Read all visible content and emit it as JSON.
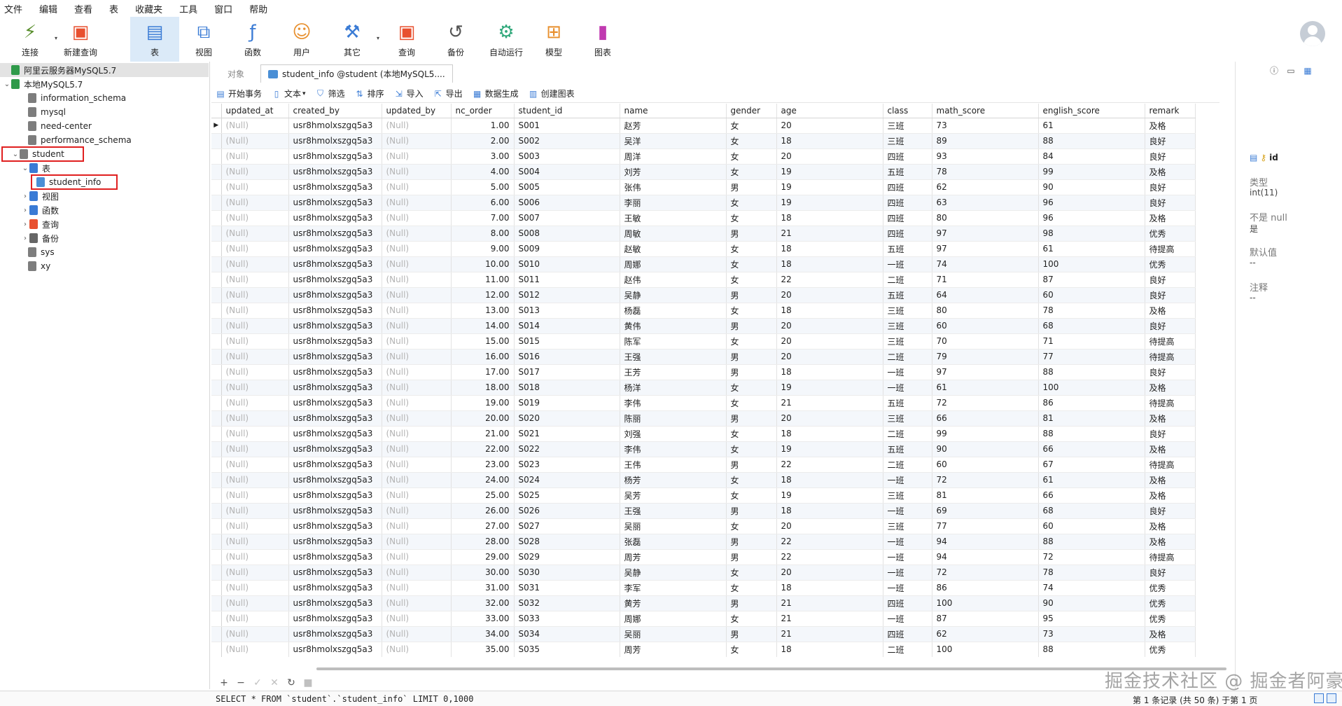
{
  "menu": [
    "文件",
    "编辑",
    "查看",
    "表",
    "收藏夹",
    "工具",
    "窗口",
    "帮助"
  ],
  "toolbar": [
    {
      "label": "连接",
      "icon": "connection-icon",
      "dropdown": true,
      "active": false,
      "color": "#5a8f2e"
    },
    {
      "label": "新建查询",
      "icon": "new-query-icon",
      "dropdown": false,
      "active": false,
      "color": "#e8502f"
    },
    {
      "label": "表",
      "icon": "table-icon",
      "dropdown": false,
      "active": true,
      "color": "#3a7bd5"
    },
    {
      "label": "视图",
      "icon": "view-icon",
      "dropdown": false,
      "active": false,
      "color": "#3a7bd5"
    },
    {
      "label": "函数",
      "icon": "function-icon",
      "dropdown": false,
      "active": false,
      "color": "#3a7bd5"
    },
    {
      "label": "用户",
      "icon": "user-icon",
      "dropdown": false,
      "active": false,
      "color": "#e8902f"
    },
    {
      "label": "其它",
      "icon": "other-tools-icon",
      "dropdown": true,
      "active": false,
      "color": "#3a7bd5"
    },
    {
      "label": "查询",
      "icon": "query-icon",
      "dropdown": false,
      "active": false,
      "color": "#e8502f"
    },
    {
      "label": "备份",
      "icon": "backup-icon",
      "dropdown": false,
      "active": false,
      "color": "#555555"
    },
    {
      "label": "自动运行",
      "icon": "auto-run-icon",
      "dropdown": false,
      "active": false,
      "color": "#2fa87a"
    },
    {
      "label": "模型",
      "icon": "model-icon",
      "dropdown": false,
      "active": false,
      "color": "#e8902f"
    },
    {
      "label": "图表",
      "icon": "chart-icon",
      "dropdown": false,
      "active": false,
      "color": "#c03ab0"
    }
  ],
  "sidebar": {
    "items": [
      {
        "label": "阿里云服务器MySQL5.7",
        "icon": "server-icon",
        "level": 0,
        "arrow": "",
        "selected": true
      },
      {
        "label": "本地MySQL5.7",
        "icon": "server-icon",
        "level": 0,
        "arrow": "⌄",
        "selected": false
      },
      {
        "label": "information_schema",
        "icon": "database-icon",
        "level": 1,
        "arrow": "",
        "selected": false
      },
      {
        "label": "mysql",
        "icon": "database-icon",
        "level": 1,
        "arrow": "",
        "selected": false
      },
      {
        "label": "need-center",
        "icon": "database-icon",
        "level": 1,
        "arrow": "",
        "selected": false
      },
      {
        "label": "performance_schema",
        "icon": "database-icon",
        "level": 1,
        "arrow": "",
        "selected": false
      },
      {
        "label": "student",
        "icon": "database-icon",
        "level": 1,
        "arrow": "⌄",
        "selected": false,
        "highlight": true
      },
      {
        "label": "表",
        "icon": "table-folder-icon",
        "level": 2,
        "arrow": "⌄",
        "selected": false
      },
      {
        "label": "student_info",
        "icon": "table-icon",
        "level": 3,
        "arrow": "",
        "selected": false,
        "highlight": true
      },
      {
        "label": "视图",
        "icon": "view-icon",
        "level": 2,
        "arrow": "›",
        "selected": false
      },
      {
        "label": "函数",
        "icon": "function-icon",
        "level": 2,
        "arrow": "›",
        "selected": false
      },
      {
        "label": "查询",
        "icon": "query-icon",
        "level": 2,
        "arrow": "›",
        "selected": false
      },
      {
        "label": "备份",
        "icon": "backup-icon",
        "level": 2,
        "arrow": "›",
        "selected": false
      },
      {
        "label": "sys",
        "icon": "database-icon",
        "level": 1,
        "arrow": "",
        "selected": false
      },
      {
        "label": "xy",
        "icon": "database-icon",
        "level": 1,
        "arrow": "",
        "selected": false
      }
    ]
  },
  "tabs": [
    {
      "label": "对象",
      "active": false
    },
    {
      "label": "student_info @student (本地MySQL5....",
      "active": true
    }
  ],
  "grid_tools": [
    {
      "label": "开始事务",
      "icon": "transaction-icon"
    },
    {
      "label": "文本",
      "icon": "text-icon"
    },
    {
      "label": "筛选",
      "icon": "filter-icon"
    },
    {
      "label": "排序",
      "icon": "sort-icon"
    },
    {
      "label": "导入",
      "icon": "import-icon"
    },
    {
      "label": "导出",
      "icon": "export-icon"
    },
    {
      "label": "数据生成",
      "icon": "data-generate-icon"
    },
    {
      "label": "创建图表",
      "icon": "create-chart-icon"
    }
  ],
  "columns": [
    "updated_at",
    "created_by",
    "updated_by",
    "nc_order",
    "student_id",
    "name",
    "gender",
    "age",
    "class",
    "math_score",
    "english_score",
    "remark"
  ],
  "rows": [
    [
      "(Null)",
      "usr8hmolxszgq5a3",
      "(Null)",
      "1.00",
      "S001",
      "赵芳",
      "女",
      "20",
      "三班",
      "73",
      "61",
      "及格"
    ],
    [
      "(Null)",
      "usr8hmolxszgq5a3",
      "(Null)",
      "2.00",
      "S002",
      "吴洋",
      "女",
      "18",
      "三班",
      "89",
      "88",
      "良好"
    ],
    [
      "(Null)",
      "usr8hmolxszgq5a3",
      "(Null)",
      "3.00",
      "S003",
      "周洋",
      "女",
      "20",
      "四班",
      "93",
      "84",
      "良好"
    ],
    [
      "(Null)",
      "usr8hmolxszgq5a3",
      "(Null)",
      "4.00",
      "S004",
      "刘芳",
      "女",
      "19",
      "五班",
      "78",
      "99",
      "及格"
    ],
    [
      "(Null)",
      "usr8hmolxszgq5a3",
      "(Null)",
      "5.00",
      "S005",
      "张伟",
      "男",
      "19",
      "四班",
      "62",
      "90",
      "良好"
    ],
    [
      "(Null)",
      "usr8hmolxszgq5a3",
      "(Null)",
      "6.00",
      "S006",
      "李丽",
      "女",
      "19",
      "四班",
      "63",
      "96",
      "良好"
    ],
    [
      "(Null)",
      "usr8hmolxszgq5a3",
      "(Null)",
      "7.00",
      "S007",
      "王敏",
      "女",
      "18",
      "四班",
      "80",
      "96",
      "及格"
    ],
    [
      "(Null)",
      "usr8hmolxszgq5a3",
      "(Null)",
      "8.00",
      "S008",
      "周敏",
      "男",
      "21",
      "四班",
      "97",
      "98",
      "优秀"
    ],
    [
      "(Null)",
      "usr8hmolxszgq5a3",
      "(Null)",
      "9.00",
      "S009",
      "赵敏",
      "女",
      "18",
      "五班",
      "97",
      "61",
      "待提高"
    ],
    [
      "(Null)",
      "usr8hmolxszgq5a3",
      "(Null)",
      "10.00",
      "S010",
      "周娜",
      "女",
      "18",
      "一班",
      "74",
      "100",
      "优秀"
    ],
    [
      "(Null)",
      "usr8hmolxszgq5a3",
      "(Null)",
      "11.00",
      "S011",
      "赵伟",
      "女",
      "22",
      "二班",
      "71",
      "87",
      "良好"
    ],
    [
      "(Null)",
      "usr8hmolxszgq5a3",
      "(Null)",
      "12.00",
      "S012",
      "吴静",
      "男",
      "20",
      "五班",
      "64",
      "60",
      "良好"
    ],
    [
      "(Null)",
      "usr8hmolxszgq5a3",
      "(Null)",
      "13.00",
      "S013",
      "杨磊",
      "女",
      "18",
      "三班",
      "80",
      "78",
      "及格"
    ],
    [
      "(Null)",
      "usr8hmolxszgq5a3",
      "(Null)",
      "14.00",
      "S014",
      "黄伟",
      "男",
      "20",
      "三班",
      "60",
      "68",
      "良好"
    ],
    [
      "(Null)",
      "usr8hmolxszgq5a3",
      "(Null)",
      "15.00",
      "S015",
      "陈军",
      "女",
      "20",
      "三班",
      "70",
      "71",
      "待提高"
    ],
    [
      "(Null)",
      "usr8hmolxszgq5a3",
      "(Null)",
      "16.00",
      "S016",
      "王强",
      "男",
      "20",
      "二班",
      "79",
      "77",
      "待提高"
    ],
    [
      "(Null)",
      "usr8hmolxszgq5a3",
      "(Null)",
      "17.00",
      "S017",
      "王芳",
      "男",
      "18",
      "一班",
      "97",
      "88",
      "良好"
    ],
    [
      "(Null)",
      "usr8hmolxszgq5a3",
      "(Null)",
      "18.00",
      "S018",
      "杨洋",
      "女",
      "19",
      "一班",
      "61",
      "100",
      "及格"
    ],
    [
      "(Null)",
      "usr8hmolxszgq5a3",
      "(Null)",
      "19.00",
      "S019",
      "李伟",
      "女",
      "21",
      "五班",
      "72",
      "86",
      "待提高"
    ],
    [
      "(Null)",
      "usr8hmolxszgq5a3",
      "(Null)",
      "20.00",
      "S020",
      "陈丽",
      "男",
      "20",
      "三班",
      "66",
      "81",
      "及格"
    ],
    [
      "(Null)",
      "usr8hmolxszgq5a3",
      "(Null)",
      "21.00",
      "S021",
      "刘强",
      "女",
      "18",
      "二班",
      "99",
      "88",
      "良好"
    ],
    [
      "(Null)",
      "usr8hmolxszgq5a3",
      "(Null)",
      "22.00",
      "S022",
      "李伟",
      "女",
      "19",
      "五班",
      "90",
      "66",
      "及格"
    ],
    [
      "(Null)",
      "usr8hmolxszgq5a3",
      "(Null)",
      "23.00",
      "S023",
      "王伟",
      "男",
      "22",
      "二班",
      "60",
      "67",
      "待提高"
    ],
    [
      "(Null)",
      "usr8hmolxszgq5a3",
      "(Null)",
      "24.00",
      "S024",
      "杨芳",
      "女",
      "18",
      "一班",
      "72",
      "61",
      "及格"
    ],
    [
      "(Null)",
      "usr8hmolxszgq5a3",
      "(Null)",
      "25.00",
      "S025",
      "吴芳",
      "女",
      "19",
      "三班",
      "81",
      "66",
      "及格"
    ],
    [
      "(Null)",
      "usr8hmolxszgq5a3",
      "(Null)",
      "26.00",
      "S026",
      "王强",
      "男",
      "18",
      "一班",
      "69",
      "68",
      "良好"
    ],
    [
      "(Null)",
      "usr8hmolxszgq5a3",
      "(Null)",
      "27.00",
      "S027",
      "吴丽",
      "女",
      "20",
      "三班",
      "77",
      "60",
      "及格"
    ],
    [
      "(Null)",
      "usr8hmolxszgq5a3",
      "(Null)",
      "28.00",
      "S028",
      "张磊",
      "男",
      "22",
      "一班",
      "94",
      "88",
      "及格"
    ],
    [
      "(Null)",
      "usr8hmolxszgq5a3",
      "(Null)",
      "29.00",
      "S029",
      "周芳",
      "男",
      "22",
      "一班",
      "94",
      "72",
      "待提高"
    ],
    [
      "(Null)",
      "usr8hmolxszgq5a3",
      "(Null)",
      "30.00",
      "S030",
      "吴静",
      "女",
      "20",
      "一班",
      "72",
      "78",
      "良好"
    ],
    [
      "(Null)",
      "usr8hmolxszgq5a3",
      "(Null)",
      "31.00",
      "S031",
      "李军",
      "女",
      "18",
      "一班",
      "86",
      "74",
      "优秀"
    ],
    [
      "(Null)",
      "usr8hmolxszgq5a3",
      "(Null)",
      "32.00",
      "S032",
      "黄芳",
      "男",
      "21",
      "四班",
      "100",
      "90",
      "优秀"
    ],
    [
      "(Null)",
      "usr8hmolxszgq5a3",
      "(Null)",
      "33.00",
      "S033",
      "周娜",
      "女",
      "21",
      "一班",
      "87",
      "95",
      "优秀"
    ],
    [
      "(Null)",
      "usr8hmolxszgq5a3",
      "(Null)",
      "34.00",
      "S034",
      "吴丽",
      "男",
      "21",
      "四班",
      "62",
      "73",
      "及格"
    ],
    [
      "(Null)",
      "usr8hmolxszgq5a3",
      "(Null)",
      "35.00",
      "S035",
      "周芳",
      "女",
      "18",
      "二班",
      "100",
      "88",
      "优秀"
    ]
  ],
  "info_panel": {
    "field_name": "id",
    "type_label": "类型",
    "type_value": "int(11)",
    "not_null_label": "不是 null",
    "not_null_value": "是",
    "default_label": "默认值",
    "default_value": "--",
    "comment_label": "注释",
    "comment_value": "--"
  },
  "navbar": [
    "+",
    "−",
    "✓",
    "✕",
    "↻",
    "■"
  ],
  "status": {
    "sql": "SELECT * FROM `student`.`student_info` LIMIT 0,1000",
    "record_info": "第 1 条记录 (共 50 条) 于第 1 页"
  },
  "watermark": "掘金技术社区 @ 掘金者阿豪",
  "colors": {
    "accent": "#3a7bd5",
    "highlight_box": "#e02020",
    "row_alt": "#f4f7fb",
    "null_text": "#b3b3b3"
  }
}
